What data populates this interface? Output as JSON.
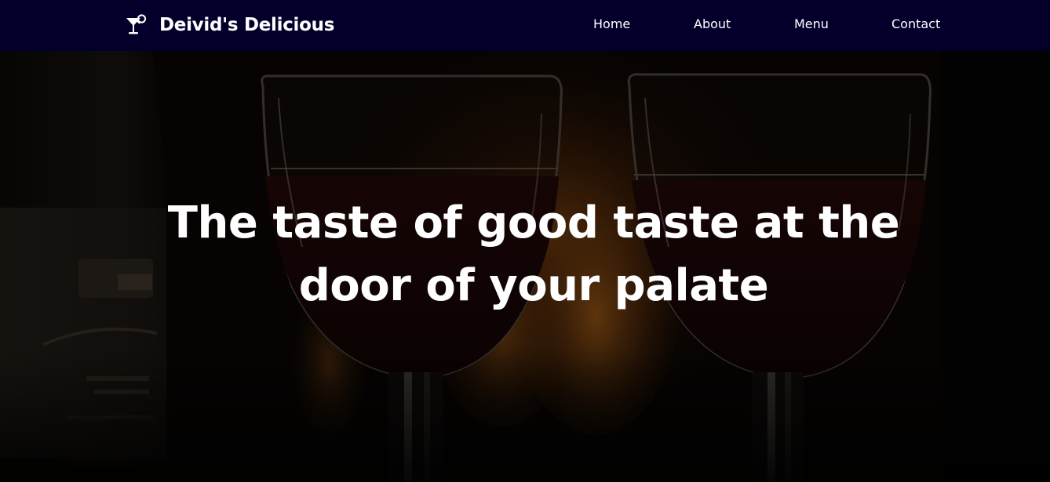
{
  "colors": {
    "navbar_background": "#02002b",
    "text": "#ffffff"
  },
  "navbar": {
    "brand_icon": "cocktail-glass-icon",
    "brand_name": "Deivid's Delicious",
    "links": [
      {
        "label": "Home"
      },
      {
        "label": "About"
      },
      {
        "label": "Menu"
      },
      {
        "label": "Contact"
      }
    ]
  },
  "hero": {
    "background": "two-glasses-of-red-wine-by-fireplace-photo",
    "headline": "The taste of good taste at the door of your palate"
  }
}
